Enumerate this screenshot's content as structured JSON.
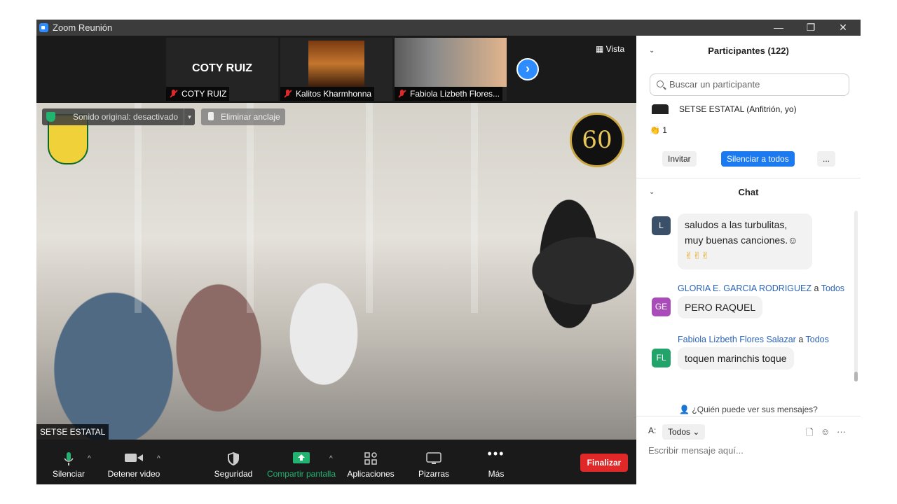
{
  "window": {
    "title": "Zoom Reunión",
    "minimize": "—",
    "restore": "❐",
    "close": "✕"
  },
  "strip": {
    "thumbs": [
      {
        "big_name": "COTY RUIZ",
        "name": "COTY RUIZ"
      },
      {
        "name": "Kalitos Kharmhonna"
      },
      {
        "name": "Fabiola Lizbeth Flores..."
      }
    ],
    "view_label": "Vista"
  },
  "main_video": {
    "audio_status": "Sonido original: desactivado",
    "unpin_label": "Eliminar anclaje",
    "logo_badge": "60",
    "speaker": "SETSE ESTATAL"
  },
  "toolbar": {
    "mute": "Silenciar",
    "video": "Detener video",
    "security": "Seguridad",
    "share": "Compartir pantalla",
    "apps": "Aplicaciones",
    "whiteboards": "Pizarras",
    "more": "Más",
    "end": "Finalizar"
  },
  "participants": {
    "header": "Participantes (122)",
    "search_placeholder": "Buscar un participante",
    "host_row": "SETSE ESTATAL (Anfitrión, yo)",
    "reaction_count": "1",
    "invite": "Invitar",
    "mute_all": "Silenciar a todos",
    "more": "..."
  },
  "chat": {
    "header": "Chat",
    "messages": [
      {
        "avatar": "L",
        "text_line1": "saludos a las turbulitas,",
        "text_line2": "muy buenas canciones.☺",
        "text_line3": "✌✌✌"
      },
      {
        "sender": "GLORIA E. GARCIA RODRIGUEZ",
        "to_word": "a",
        "to": "Todos",
        "avatar": "GE",
        "text": "PERO RAQUEL"
      },
      {
        "sender": "Fabiola Lizbeth Flores Salazar",
        "to_word": "a",
        "to": "Todos",
        "avatar": "FL",
        "text": "toquen marinchis toque"
      }
    ],
    "who_can_see": "¿Quién puede ver sus mensajes?",
    "to_label": "A:",
    "to_value": "Todos",
    "input_placeholder": "Escribir mensaje aquí..."
  },
  "colors": {
    "accent": "#2d8cff",
    "end": "#e02828",
    "share": "#21b36f"
  }
}
